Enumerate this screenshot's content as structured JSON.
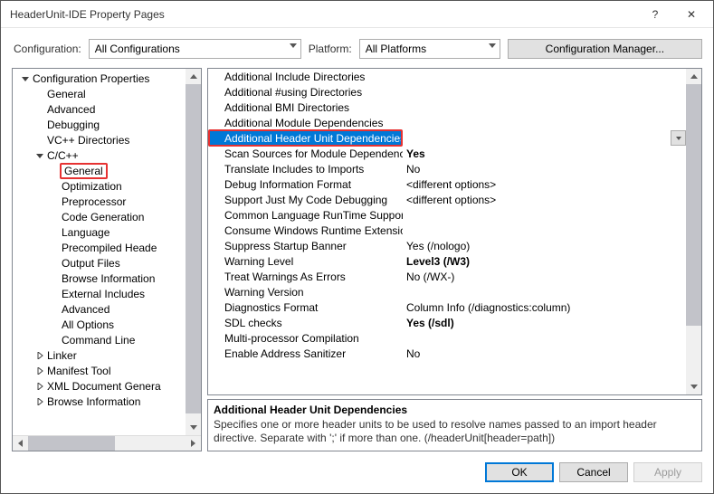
{
  "title": "HeaderUnit-IDE Property Pages",
  "help_glyph": "?",
  "close_glyph": "✕",
  "config": {
    "label": "Configuration:",
    "value": "All Configurations",
    "platform_label": "Platform:",
    "platform_value": "All Platforms",
    "manager": "Configuration Manager..."
  },
  "tree": [
    {
      "lvl": 0,
      "exp": "open",
      "label": "Configuration Properties"
    },
    {
      "lvl": 1,
      "exp": "",
      "label": "General"
    },
    {
      "lvl": 1,
      "exp": "",
      "label": "Advanced"
    },
    {
      "lvl": 1,
      "exp": "",
      "label": "Debugging"
    },
    {
      "lvl": 1,
      "exp": "",
      "label": "VC++ Directories"
    },
    {
      "lvl": 1,
      "exp": "open",
      "label": "C/C++"
    },
    {
      "lvl": 2,
      "exp": "",
      "label": "General",
      "boxed": true
    },
    {
      "lvl": 2,
      "exp": "",
      "label": "Optimization"
    },
    {
      "lvl": 2,
      "exp": "",
      "label": "Preprocessor"
    },
    {
      "lvl": 2,
      "exp": "",
      "label": "Code Generation"
    },
    {
      "lvl": 2,
      "exp": "",
      "label": "Language"
    },
    {
      "lvl": 2,
      "exp": "",
      "label": "Precompiled Heade"
    },
    {
      "lvl": 2,
      "exp": "",
      "label": "Output Files"
    },
    {
      "lvl": 2,
      "exp": "",
      "label": "Browse Information"
    },
    {
      "lvl": 2,
      "exp": "",
      "label": "External Includes"
    },
    {
      "lvl": 2,
      "exp": "",
      "label": "Advanced"
    },
    {
      "lvl": 2,
      "exp": "",
      "label": "All Options"
    },
    {
      "lvl": 2,
      "exp": "",
      "label": "Command Line"
    },
    {
      "lvl": 1,
      "exp": "closed",
      "label": "Linker"
    },
    {
      "lvl": 1,
      "exp": "closed",
      "label": "Manifest Tool"
    },
    {
      "lvl": 1,
      "exp": "closed",
      "label": "XML Document Genera"
    },
    {
      "lvl": 1,
      "exp": "closed",
      "label": "Browse Information"
    }
  ],
  "grid": [
    {
      "name": "Additional Include Directories",
      "val": ""
    },
    {
      "name": "Additional #using Directories",
      "val": ""
    },
    {
      "name": "Additional BMI Directories",
      "val": ""
    },
    {
      "name": "Additional Module Dependencies",
      "val": ""
    },
    {
      "name": "Additional Header Unit Dependencies",
      "val": "",
      "sel": true
    },
    {
      "name": "Scan Sources for Module Dependencies",
      "val": "Yes",
      "bold": true
    },
    {
      "name": "Translate Includes to Imports",
      "val": "No"
    },
    {
      "name": "Debug Information Format",
      "val": "<different options>"
    },
    {
      "name": "Support Just My Code Debugging",
      "val": "<different options>"
    },
    {
      "name": "Common Language RunTime Support",
      "val": ""
    },
    {
      "name": "Consume Windows Runtime Extension",
      "val": ""
    },
    {
      "name": "Suppress Startup Banner",
      "val": "Yes (/nologo)"
    },
    {
      "name": "Warning Level",
      "val": "Level3 (/W3)",
      "bold": true
    },
    {
      "name": "Treat Warnings As Errors",
      "val": "No (/WX-)"
    },
    {
      "name": "Warning Version",
      "val": ""
    },
    {
      "name": "Diagnostics Format",
      "val": "Column Info (/diagnostics:column)"
    },
    {
      "name": "SDL checks",
      "val": "Yes (/sdl)",
      "bold": true
    },
    {
      "name": "Multi-processor Compilation",
      "val": ""
    },
    {
      "name": "Enable Address Sanitizer",
      "val": "No"
    }
  ],
  "desc": {
    "title": "Additional Header Unit Dependencies",
    "text": "Specifies one or more header units to be used to resolve names passed to an import header directive. Separate with ';' if more than one.  (/headerUnit[header=path])"
  },
  "buttons": {
    "ok": "OK",
    "cancel": "Cancel",
    "apply": "Apply"
  }
}
